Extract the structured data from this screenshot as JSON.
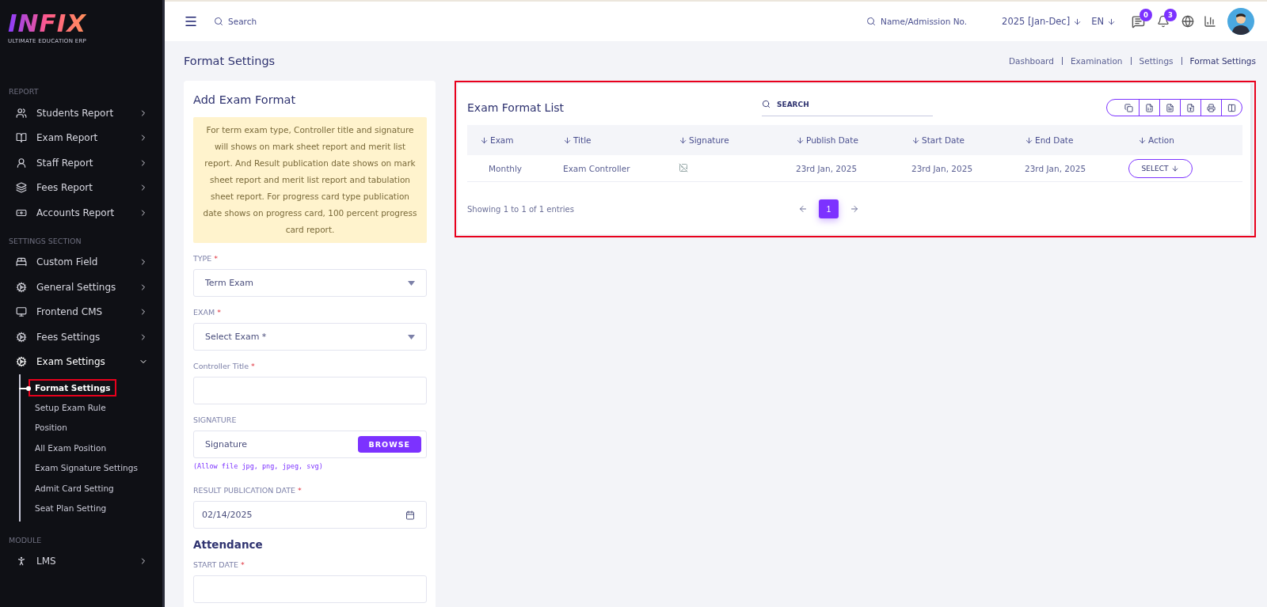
{
  "logo": {
    "name": "INFIX",
    "tagline": "ULTIMATE EDUCATION ERP"
  },
  "sidebar": {
    "sections": [
      {
        "title": "REPORT",
        "items": [
          {
            "label": "Students Report",
            "expanded": false
          },
          {
            "label": "Exam Report",
            "expanded": false
          },
          {
            "label": "Staff Report",
            "expanded": false
          },
          {
            "label": "Fees Report",
            "expanded": false
          },
          {
            "label": "Accounts Report",
            "expanded": false
          }
        ]
      },
      {
        "title": "SETTINGS SECTION",
        "items": [
          {
            "label": "Custom Field",
            "expanded": false
          },
          {
            "label": "General Settings",
            "expanded": false
          },
          {
            "label": "Frontend CMS",
            "expanded": false
          },
          {
            "label": "Fees Settings",
            "expanded": false
          },
          {
            "label": "Exam Settings",
            "expanded": true,
            "children": [
              {
                "label": "Format Settings",
                "selected": true,
                "highlighted": true
              },
              {
                "label": "Setup Exam Rule",
                "selected": false,
                "highlighted": false
              },
              {
                "label": "Position",
                "selected": false,
                "highlighted": false
              },
              {
                "label": "All Exam Position",
                "selected": false,
                "highlighted": false
              },
              {
                "label": "Exam Signature Settings",
                "selected": false,
                "highlighted": false
              },
              {
                "label": "Admit Card Setting",
                "selected": false,
                "highlighted": false
              },
              {
                "label": "Seat Plan Setting",
                "selected": false,
                "highlighted": false
              }
            ]
          }
        ]
      },
      {
        "title": "MODULE",
        "items": [
          {
            "label": "LMS",
            "expanded": false
          }
        ]
      }
    ]
  },
  "header": {
    "search": {
      "placeholder": "Search"
    },
    "student_search": {
      "placeholder": "Name/Admission No."
    },
    "session": "2025 [Jan-Dec]",
    "language": "EN",
    "messages_count": "0",
    "notifications_count": "3"
  },
  "page_title": "Format Settings",
  "breadcrumbs": [
    {
      "label": "Dashboard",
      "selected": false
    },
    {
      "label": "Examination",
      "selected": false
    },
    {
      "label": "Settings",
      "selected": false
    },
    {
      "label": "Format Settings",
      "selected": true
    }
  ],
  "form": {
    "title": "Add Exam Format",
    "notice": "For term exam type, Controller title and signature will shows on mark sheet report and merit list report. And Result publication date shows on mark sheet report and merit list report and tabulation sheet report. For progress card type publication date shows on progress card, 100 percent progress card report.",
    "fields": [
      {
        "kind": "select",
        "label": "TYPE",
        "required_mark": "*",
        "value": "Term Exam"
      },
      {
        "kind": "select",
        "label": "EXAM",
        "required_mark": "*",
        "placeholder": "Select Exam *"
      },
      {
        "kind": "text",
        "label": "Controller Title",
        "required_mark": "*"
      },
      {
        "kind": "file",
        "label": "SIGNATURE",
        "placeholder": "Signature",
        "button": "BROWSE",
        "hint": "(Allow file jpg, png, jpeg, svg)"
      },
      {
        "kind": "date",
        "label": "RESULT PUBLICATION DATE",
        "required_mark": "*",
        "value": "02/14/2025"
      },
      {
        "kind": "heading",
        "label": "Attendance"
      },
      {
        "kind": "text",
        "label": "START DATE",
        "required_mark": "*"
      }
    ]
  },
  "list": {
    "title": "Exam Format List",
    "highlighted": true,
    "search": {
      "placeholder": "SEARCH"
    },
    "columns": [
      "Exam",
      "Title",
      "Signature",
      "Publish Date",
      "Start Date",
      "End Date",
      "Action"
    ],
    "rows": [
      {
        "exam": "Monthly",
        "title": "Exam Controller",
        "publish_date": "23rd Jan, 2025",
        "start_date": "23rd Jan, 2025",
        "end_date": "23rd Jan, 2025",
        "action": "SELECT"
      }
    ],
    "info": "Showing 1 to 1 of 1 entries",
    "pages": [
      {
        "label": "1",
        "selected": true
      }
    ]
  }
}
